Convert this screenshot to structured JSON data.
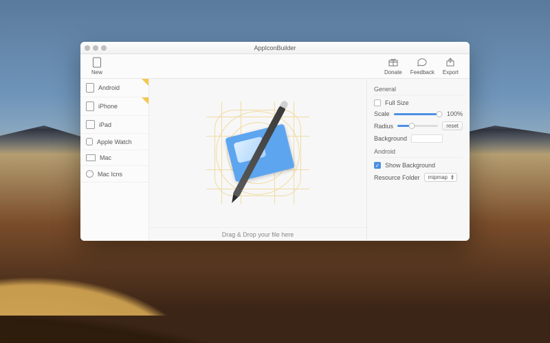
{
  "window": {
    "title": "AppIconBuilder"
  },
  "toolbar": {
    "new": "New",
    "donate": "Donate",
    "feedback": "Feedback",
    "export": "Export"
  },
  "sidebar": {
    "items": [
      {
        "label": "Android",
        "flag": true
      },
      {
        "label": "iPhone",
        "flag": true
      },
      {
        "label": "iPad",
        "flag": false
      },
      {
        "label": "Apple Watch",
        "flag": false
      },
      {
        "label": "Mac",
        "flag": false
      },
      {
        "label": "Mac Icns",
        "flag": false
      }
    ]
  },
  "center": {
    "drop_hint": "Drag & Drop your file here"
  },
  "inspector": {
    "general": {
      "heading": "General",
      "full_size_label": "Full Size",
      "full_size_checked": false,
      "scale_label": "Scale",
      "scale_value": "100%",
      "scale_percent": 100,
      "radius_label": "Radius",
      "radius_percent": 35,
      "radius_reset": "reset",
      "background_label": "Background"
    },
    "android": {
      "heading": "Android",
      "show_bg_label": "Show Background",
      "show_bg_checked": true,
      "res_folder_label": "Resource Folder",
      "res_folder_value": "mipmap"
    }
  }
}
